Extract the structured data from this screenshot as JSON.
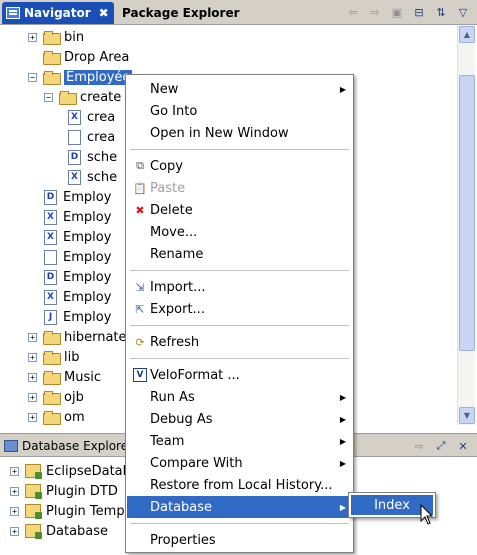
{
  "top_tabs": {
    "navigator_label": "Navigator",
    "close_glyph": "✖",
    "package_explorer_label": "Package Explorer"
  },
  "toolbar_icons": [
    "back-arrow-icon",
    "forward-arrow-icon",
    "go-into-icon",
    "collapse-all-icon",
    "link-with-editor-icon",
    "view-menu-icon"
  ],
  "tree": {
    "items": [
      {
        "label": "bin",
        "type": "folder",
        "expander": "+",
        "depth": 1
      },
      {
        "label": "Drop Area",
        "type": "folder",
        "expander": "",
        "depth": 1
      },
      {
        "label": "Employée",
        "type": "folder",
        "expander": "−",
        "depth": 1,
        "selected": true
      },
      {
        "label": "create",
        "type": "folder",
        "expander": "−",
        "depth": 2
      },
      {
        "label": "crea",
        "type": "file",
        "icon": "X",
        "depth": 3
      },
      {
        "label": "crea",
        "type": "file",
        "icon": "",
        "depth": 3
      },
      {
        "label": "sche",
        "type": "file",
        "icon": "D",
        "depth": 3
      },
      {
        "label": "sche",
        "type": "file",
        "icon": "X",
        "depth": 3
      },
      {
        "label": "Employ",
        "type": "file",
        "icon": "D",
        "depth": 2
      },
      {
        "label": "Employ",
        "type": "file",
        "icon": "X",
        "depth": 2
      },
      {
        "label": "Employ",
        "type": "file",
        "icon": "X",
        "depth": 2
      },
      {
        "label": "Employ",
        "type": "file",
        "icon": "",
        "depth": 2
      },
      {
        "label": "Employ",
        "type": "file",
        "icon": "D",
        "depth": 2
      },
      {
        "label": "Employ",
        "type": "file",
        "icon": "X",
        "depth": 2
      },
      {
        "label": "Employ",
        "type": "file",
        "icon": "J",
        "depth": 2
      },
      {
        "label": "hibernate",
        "type": "folder",
        "expander": "+",
        "depth": 1
      },
      {
        "label": "lib",
        "type": "folder",
        "expander": "+",
        "depth": 1
      },
      {
        "label": "Music",
        "type": "folder",
        "expander": "+",
        "depth": 1
      },
      {
        "label": "ojb",
        "type": "folder",
        "expander": "+",
        "depth": 1
      },
      {
        "label": "om",
        "type": "folder",
        "expander": "+",
        "depth": 1
      }
    ]
  },
  "bottom_view": {
    "tab_label": "Database Explorer",
    "items": [
      {
        "label": "EclipseDataba",
        "expander": "+"
      },
      {
        "label": "Plugin DTD",
        "expander": "+"
      },
      {
        "label": "Plugin Templa",
        "expander": "+"
      },
      {
        "label": "Database",
        "expander": "+"
      }
    ]
  },
  "context_menu": {
    "items": [
      {
        "label": "New",
        "submenu": true
      },
      {
        "label": "Go Into"
      },
      {
        "label": "Open in New Window"
      },
      {
        "separator": true
      },
      {
        "label": "Copy",
        "icon": "copy-icon"
      },
      {
        "label": "Paste",
        "icon": "paste-icon",
        "disabled": true
      },
      {
        "label": "Delete",
        "icon": "delete-icon"
      },
      {
        "label": "Move..."
      },
      {
        "label": "Rename"
      },
      {
        "separator": true
      },
      {
        "label": "Import...",
        "icon": "import-icon"
      },
      {
        "label": "Export...",
        "icon": "export-icon"
      },
      {
        "separator": true
      },
      {
        "label": "Refresh",
        "icon": "refresh-icon"
      },
      {
        "separator": true
      },
      {
        "label": "VeloFormat ...",
        "icon": "veloformat-icon"
      },
      {
        "label": "Run As",
        "submenu": true
      },
      {
        "label": "Debug As",
        "submenu": true
      },
      {
        "label": "Team",
        "submenu": true
      },
      {
        "label": "Compare With",
        "submenu": true
      },
      {
        "label": "Restore from Local History..."
      },
      {
        "label": "Database",
        "submenu": true,
        "highlighted": true
      },
      {
        "separator": true
      },
      {
        "label": "Properties"
      }
    ]
  },
  "submenu": {
    "label": "Index"
  },
  "colors": {
    "selection": "#316ac5",
    "active_tab": "#1a4fb8",
    "panel_gray": "#d4d0c8"
  }
}
